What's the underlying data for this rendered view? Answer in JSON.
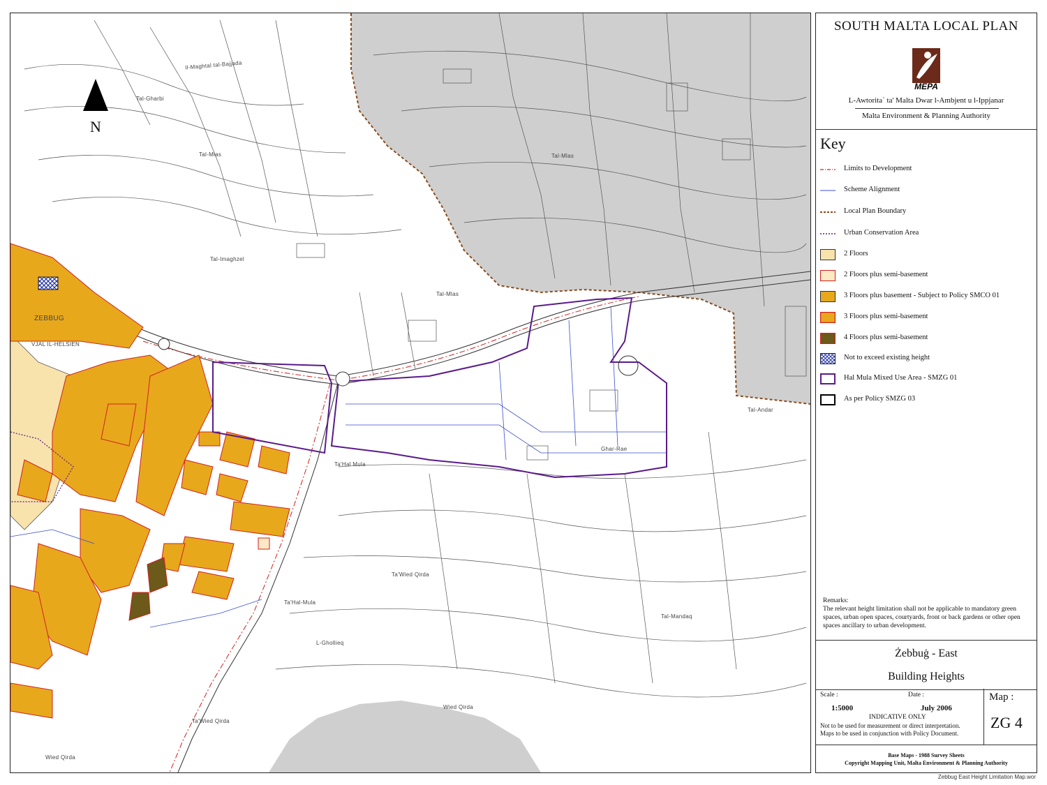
{
  "map": {
    "north_label": "N",
    "place_labels": [
      {
        "id": "tal-gharbi",
        "text": "Tal-Gharbi"
      },
      {
        "id": "il-maghtab",
        "text": "Il-Maghtal tal-Bajjada"
      },
      {
        "id": "tal-mlas-1",
        "text": "Tal-Mlas"
      },
      {
        "id": "tal-mlas-2",
        "text": "Tal-Mlas"
      },
      {
        "id": "tal-mlas-3",
        "text": "Tal-Mlas"
      },
      {
        "id": "tal-imaghzel",
        "text": "Tal-Imaghzel"
      },
      {
        "id": "zebbug",
        "text": "ZEBBUG"
      },
      {
        "id": "vjal",
        "text": "VJAL IL-HELSIEN"
      },
      {
        "id": "ghar-rae",
        "text": "Ghar-Rae"
      },
      {
        "id": "tal-andar",
        "text": "Tal-Andar"
      },
      {
        "id": "ta-hal-mula-1",
        "text": "Ta'Hal Mula"
      },
      {
        "id": "ta-hal-mula-2",
        "text": "Ta'Hal-Mula"
      },
      {
        "id": "ta-wied-qirda-1",
        "text": "Ta'Wied Qirda"
      },
      {
        "id": "ta-wied-qirda-2",
        "text": "Ta'Wied Qirda"
      },
      {
        "id": "l-ghollieq",
        "text": "L-Ghollieq"
      },
      {
        "id": "tal-mandaq",
        "text": "Tal-Mandaq"
      },
      {
        "id": "wied-qirda-1",
        "text": "Wied Qirda"
      },
      {
        "id": "wied-qirda-2",
        "text": "Wied Qirda"
      }
    ]
  },
  "panel": {
    "title": "SOUTH MALTA LOCAL PLAN",
    "logo_text": "MEPA",
    "org_maltese": "L-Awtorita` ta' Malta Dwar l-Ambjent u l-Ippjanar",
    "org_english": "Malta Environment & Planning Authority",
    "key_title": "Key",
    "key_items": [
      {
        "label": "Limits to Development",
        "symbol": "dashdot-red"
      },
      {
        "label": "Scheme Alignment",
        "symbol": "line-blue"
      },
      {
        "label": "Local Plan Boundary",
        "symbol": "dash-brown"
      },
      {
        "label": "Urban Conservation Area",
        "symbol": "dot-purple"
      },
      {
        "label": "2 Floors",
        "symbol": "fill-light",
        "color": "#f8e3ad"
      },
      {
        "label": "2 Floors plus semi-basement",
        "symbol": "fill-light-redborder",
        "color": "#fde9c6"
      },
      {
        "label": "3 Floors plus basement - Subject to Policy SMCO 01",
        "symbol": "fill-orange",
        "color": "#e8a81c"
      },
      {
        "label": "3 Floors plus semi-basement",
        "symbol": "fill-orange-redborder",
        "color": "#e8a81c"
      },
      {
        "label": "4 Floors plus semi-basement",
        "symbol": "fill-olive",
        "color": "#6b5a1a"
      },
      {
        "label": "Not to exceed existing height",
        "symbol": "hatch-blue"
      },
      {
        "label": "Hal Mula Mixed Use Area - SMZG 01",
        "symbol": "box-purple"
      },
      {
        "label": "As per Policy SMZG 03",
        "symbol": "box-black"
      }
    ],
    "remarks_title": "Remarks:",
    "remarks_text": "The relevant height limitation shall not be applicable to mandatory green spaces, urban open spaces, courtyards, front or back gardens or other open spaces ancillary to urban development.",
    "locality": "Żebbuġ -  East",
    "map_subject": "Building Heights",
    "scale_label": "Scale :",
    "scale_value": "1:5000",
    "date_label": "Date :",
    "date_value": "July 2006",
    "indicative": "INDICATIVE ONLY",
    "disclaimer_1": "Not to be used for measurement or direct interpretation.",
    "disclaimer_2": "Maps to be used in conjunction with Policy Document.",
    "map_label": "Map :",
    "map_number": "ZG 4",
    "footer_1": "Base Maps - 1988 Survey Sheets",
    "footer_2": "Copyright Mapping Unit, Malta Environment & Planning Authority"
  },
  "filename": "Zebbug East Height Limitation Map.wor",
  "colors": {
    "grey_area": "#cfcfcf",
    "orange": "#e8a81c",
    "light": "#f8e3ad",
    "olive": "#6b5a1a",
    "purple": "#5a1a8a",
    "red": "#d02020",
    "blue": "#3a4fd0",
    "brown": "#8a4a1a"
  }
}
